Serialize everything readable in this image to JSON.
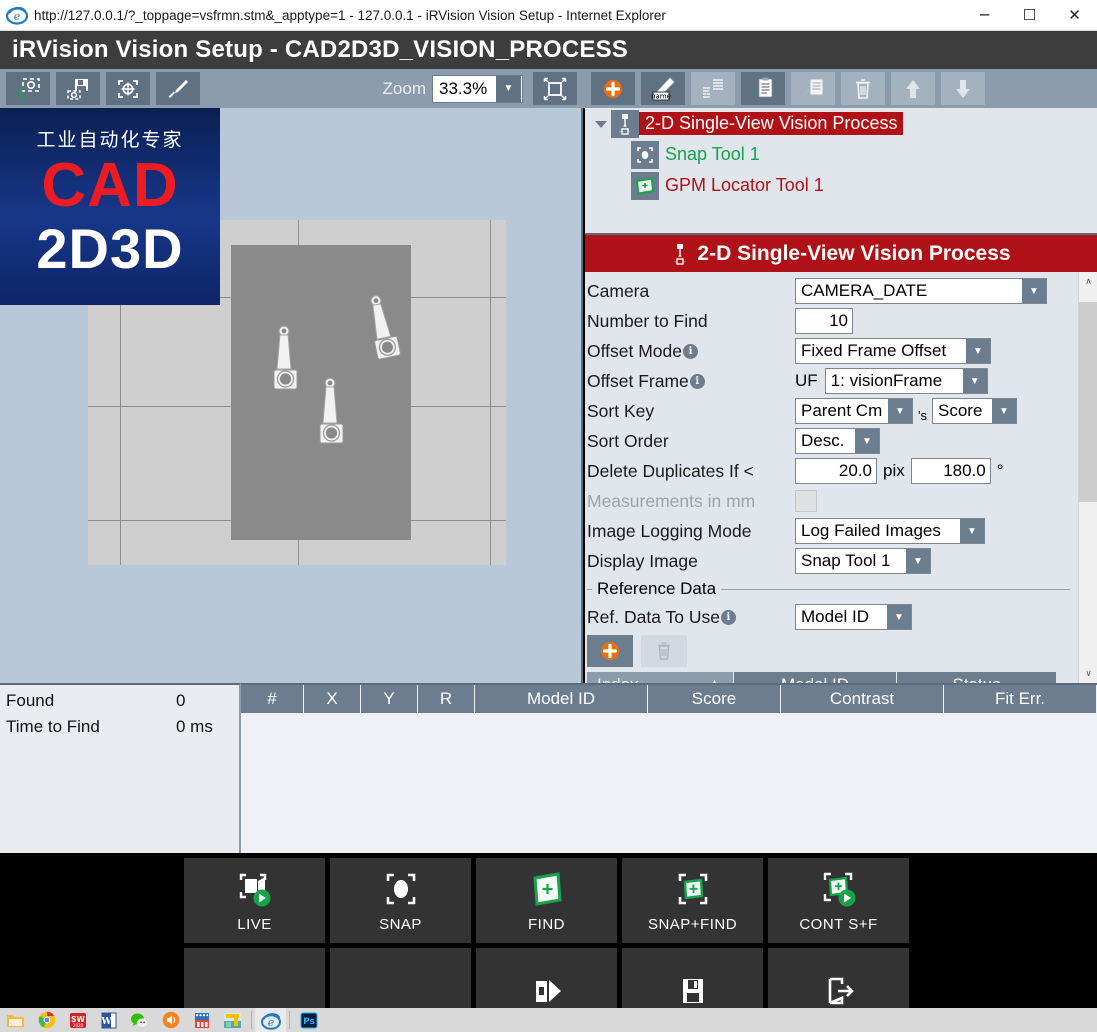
{
  "window": {
    "ie_title": "http://127.0.0.1/?_toppage=vsfrmn.stm&_apptype=1 - 127.0.0.1 - iRVision Vision Setup - Internet Explorer",
    "minimize": "─",
    "maximize": "☐",
    "close": "✕",
    "app_title": "iRVision Vision Setup - CAD2D3D_VISION_PROCESS"
  },
  "toolbar": {
    "left_buttons": [
      {
        "name": "load-image-button",
        "icon": "camera-load-icon",
        "disabled": false
      },
      {
        "name": "save-image-button",
        "icon": "floppy-save-icon",
        "disabled": false
      },
      {
        "name": "snap-target-button",
        "icon": "target-frame-icon",
        "disabled": false
      },
      {
        "name": "eyedropper-button",
        "icon": "eyedropper-icon",
        "disabled": false
      }
    ],
    "zoom_label": "Zoom",
    "zoom_value": "33.3%",
    "zoom_arrow": "▼",
    "fit_button": "fit-to-window-icon",
    "right_buttons": [
      {
        "name": "new-vision-process-button",
        "icon": "plus-circle-icon",
        "disabled": false
      },
      {
        "name": "rename-button",
        "icon": "pencil-name-icon",
        "disabled": false
      },
      {
        "name": "copy-button",
        "icon": "copy-list-icon",
        "disabled": true
      },
      {
        "name": "paste-button",
        "icon": "clipboard-icon",
        "disabled": false
      },
      {
        "name": "load-list-button",
        "icon": "document-load-icon",
        "disabled": true
      },
      {
        "name": "delete-button",
        "icon": "trash-icon",
        "disabled": true
      },
      {
        "name": "move-up-button",
        "icon": "arrow-up-icon",
        "disabled": true
      },
      {
        "name": "move-down-button",
        "icon": "arrow-down-icon",
        "disabled": true
      }
    ]
  },
  "logo": {
    "cn_text": "工业自动化专家",
    "line1": "CAD",
    "line2": "2D3D",
    "red": "#ec1c24",
    "blue": "#14307d"
  },
  "tree": {
    "expander": "▼",
    "items": [
      {
        "label": "2-D Single-View Vision Process",
        "icon": "vision-process-icon",
        "selected": true,
        "color": "#ffffff",
        "level": 0
      },
      {
        "label": "Snap Tool 1",
        "icon": "snap-tool-icon",
        "selected": false,
        "color": "#16a34a",
        "level": 1
      },
      {
        "label": "GPM Locator Tool 1",
        "icon": "gpm-locator-icon",
        "selected": false,
        "color": "#b01116",
        "level": 1
      }
    ]
  },
  "properties": {
    "title": "2-D Single-View Vision Process",
    "title_icon": "vision-process-icon",
    "accent": "#b01116",
    "fields": {
      "camera_label": "Camera",
      "camera_value": "CAMERA_DATE",
      "number_to_find_label": "Number to Find",
      "number_to_find_value": "10",
      "offset_mode_label": "Offset Mode",
      "offset_mode_value": "Fixed Frame Offset",
      "offset_frame_label": "Offset Frame",
      "offset_frame_prefix": "UF",
      "offset_frame_value": "1: visionFrame",
      "sort_key_label": "Sort Key",
      "sort_key_value": "Parent Cm",
      "sort_key_possessive": "'s",
      "sort_key_value2": "Score",
      "sort_order_label": "Sort Order",
      "sort_order_value": "Desc.",
      "delete_duplicates_label": "Delete Duplicates If <",
      "delete_duplicates_pix": "20.0",
      "delete_duplicates_pix_unit": "pix",
      "delete_duplicates_deg": "180.0",
      "delete_duplicates_deg_unit": "°",
      "measurements_mm_label": "Measurements in mm",
      "measurements_mm_checked": false,
      "image_logging_label": "Image Logging Mode",
      "image_logging_value": "Log Failed Images",
      "display_image_label": "Display Image",
      "display_image_value": "Snap Tool 1",
      "reference_data_group": "Reference Data",
      "ref_data_to_use_label": "Ref. Data To Use",
      "ref_data_to_use_value": "Model ID"
    },
    "ref_buttons": [
      {
        "name": "add-reference-data-button",
        "icon": "plus-circle-icon",
        "disabled": false
      },
      {
        "name": "delete-reference-data-button",
        "icon": "trash-icon",
        "disabled": true
      }
    ],
    "ref_table_headers": [
      "Index",
      "Model ID",
      "Status"
    ],
    "ref_sort_arrow": "▲",
    "dropdown_arrow": "▼",
    "scroll_up": "∧",
    "scroll_down": "∨"
  },
  "status": {
    "found_label": "Found",
    "found_value": "0",
    "time_label": "Time to Find",
    "time_value": "0 ms"
  },
  "results_table": {
    "columns": [
      "#",
      "X",
      "Y",
      "R",
      "Model ID",
      "Score",
      "Contrast",
      "Fit Err."
    ],
    "rows": []
  },
  "action_buttons": {
    "row1": [
      {
        "label": "LIVE",
        "icon": "live-camera-icon",
        "name": "live-button"
      },
      {
        "label": "SNAP",
        "icon": "snap-camera-icon",
        "name": "snap-button"
      },
      {
        "label": "FIND",
        "icon": "find-shape-icon",
        "name": "find-button"
      },
      {
        "label": "SNAP+FIND",
        "icon": "snap-find-icon",
        "name": "snap-find-button"
      },
      {
        "label": "CONT S+F",
        "icon": "continuous-snap-find-icon",
        "name": "cont-snap-find-button"
      }
    ],
    "row2": [
      {
        "label": "",
        "icon": "",
        "name": "blank-button-1"
      },
      {
        "label": "",
        "icon": "",
        "name": "blank-button-2"
      },
      {
        "label": "",
        "icon": "run-program-icon",
        "name": "run-program-button"
      },
      {
        "label": "",
        "icon": "floppy-save-icon",
        "name": "save-button"
      },
      {
        "label": "",
        "icon": "exit-icon",
        "name": "exit-button"
      }
    ]
  },
  "taskbar": {
    "items": [
      {
        "name": "file-explorer-icon",
        "active": false
      },
      {
        "name": "chrome-icon",
        "active": false
      },
      {
        "name": "solidworks-icon",
        "active": false
      },
      {
        "name": "word-icon",
        "active": false
      },
      {
        "name": "wechat-icon",
        "active": false
      },
      {
        "name": "sound-app-icon",
        "active": false
      },
      {
        "name": "media-app-icon",
        "active": false
      },
      {
        "name": "robot-app-icon",
        "active": false
      },
      {
        "name": "internet-explorer-icon",
        "active": true
      },
      {
        "name": "photoshop-icon",
        "active": false
      }
    ]
  }
}
